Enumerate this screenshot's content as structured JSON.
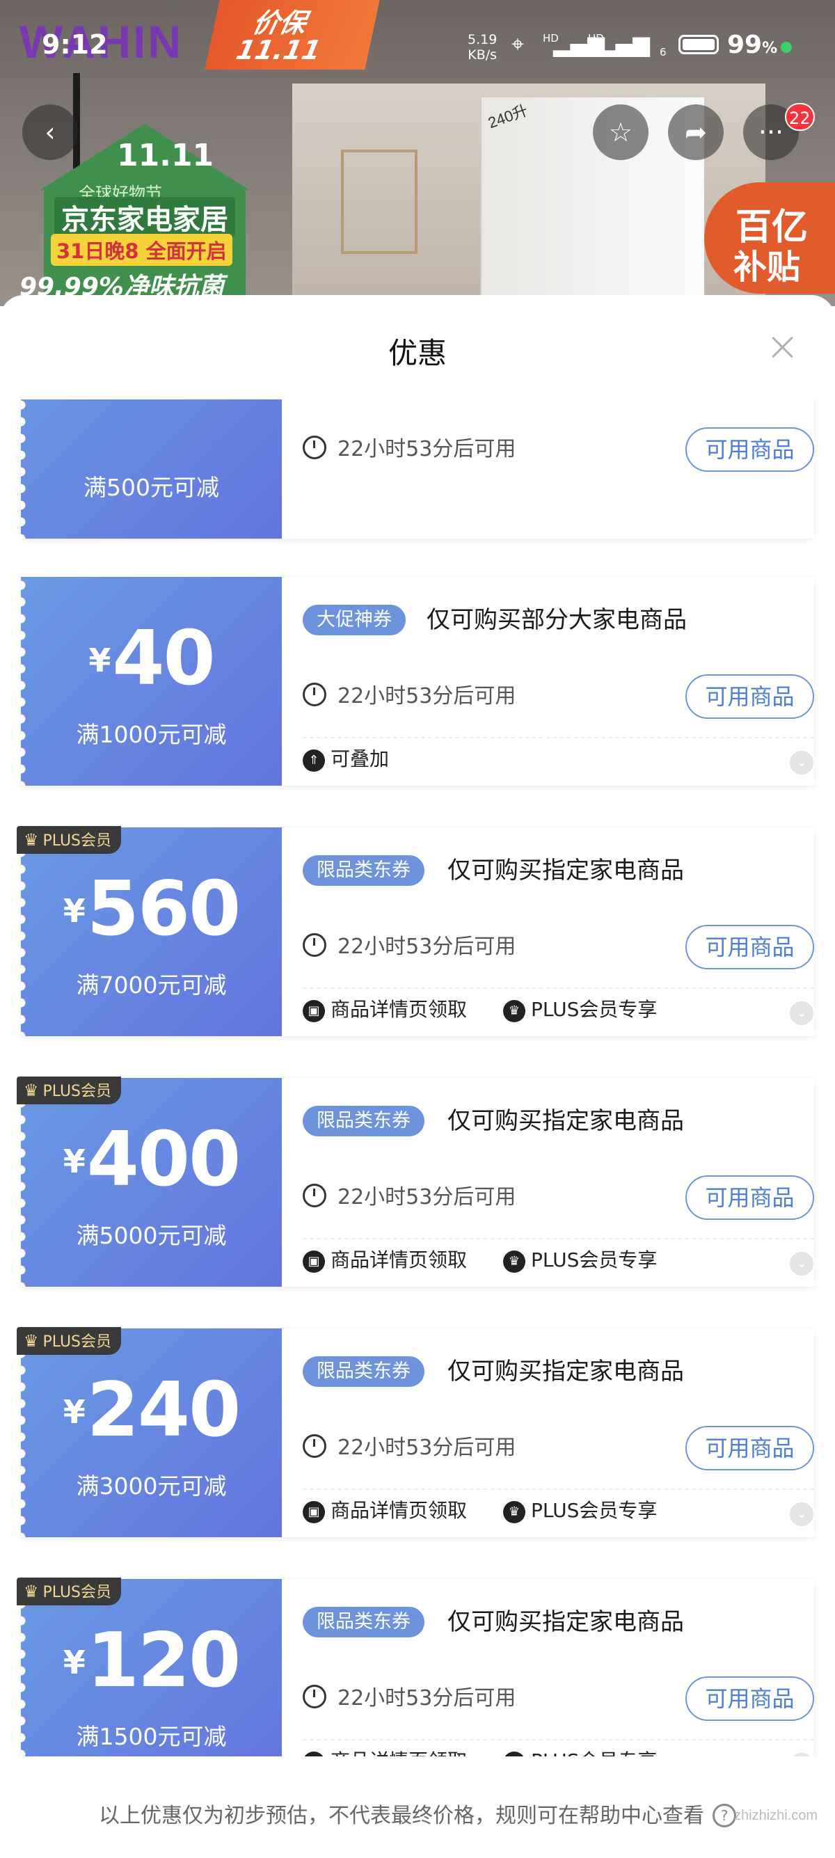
{
  "status_bar": {
    "time": "9:12",
    "net_speed": "5.19",
    "net_unit": "KB/s",
    "signal1_label": "HD",
    "signal2_label": "HD",
    "wifi_label": "6",
    "battery": "99",
    "battery_unit": "%"
  },
  "banner": {
    "brand": "WAHIN",
    "flag_line1": "价保",
    "flag_line2": "11.11",
    "house_title": "11.11",
    "house_sub": "全球好物节",
    "house_main": "京东家电家居",
    "house_date": "31日晚8 全面开启",
    "house_claim": "99.99%净味抗菌",
    "fridge_tag": "240升",
    "subsidy_line1": "百亿",
    "subsidy_line2": "补贴",
    "cart_badge": "22"
  },
  "sheet": {
    "title": "优惠",
    "footer": "以上优惠仅为初步预估，不代表最终价格，规则可在帮助中心查看"
  },
  "coupons": [
    {
      "amount": "",
      "condition": "满500元可减",
      "plus": false,
      "tag": "",
      "scope": "",
      "timer": "22小时53分后可用",
      "button": "可用商品",
      "features": []
    },
    {
      "amount": "40",
      "condition": "满1000元可减",
      "plus": false,
      "tag": "大促神券",
      "scope": "仅可购买部分大家电商品",
      "timer": "22小时53分后可用",
      "button": "可用商品",
      "features": [
        "可叠加"
      ]
    },
    {
      "amount": "560",
      "condition": "满7000元可减",
      "plus": true,
      "plus_label": "PLUS会员",
      "tag": "限品类东券",
      "scope": "仅可购买指定家电商品",
      "timer": "22小时53分后可用",
      "button": "可用商品",
      "features": [
        "商品详情页领取",
        "PLUS会员专享"
      ]
    },
    {
      "amount": "400",
      "condition": "满5000元可减",
      "plus": true,
      "plus_label": "PLUS会员",
      "tag": "限品类东券",
      "scope": "仅可购买指定家电商品",
      "timer": "22小时53分后可用",
      "button": "可用商品",
      "features": [
        "商品详情页领取",
        "PLUS会员专享"
      ]
    },
    {
      "amount": "240",
      "condition": "满3000元可减",
      "plus": true,
      "plus_label": "PLUS会员",
      "tag": "限品类东券",
      "scope": "仅可购买指定家电商品",
      "timer": "22小时53分后可用",
      "button": "可用商品",
      "features": [
        "商品详情页领取",
        "PLUS会员专享"
      ]
    },
    {
      "amount": "120",
      "condition": "满1500元可减",
      "plus": true,
      "plus_label": "PLUS会员",
      "tag": "限品类东券",
      "scope": "仅可购买指定家电商品",
      "timer": "22小时53分后可用",
      "button": "可用商品",
      "features": [
        "商品详情页领取",
        "PLUS会员专享"
      ]
    }
  ],
  "currency": "¥",
  "watermark": "zhizhizhi.com",
  "colors": {
    "coupon_gradient_start": "#6a9ae3",
    "coupon_gradient_end": "#6374de",
    "pill_blue": "#6c93db",
    "plus_gold": "#f3d692",
    "badge_red": "#f4333c"
  }
}
